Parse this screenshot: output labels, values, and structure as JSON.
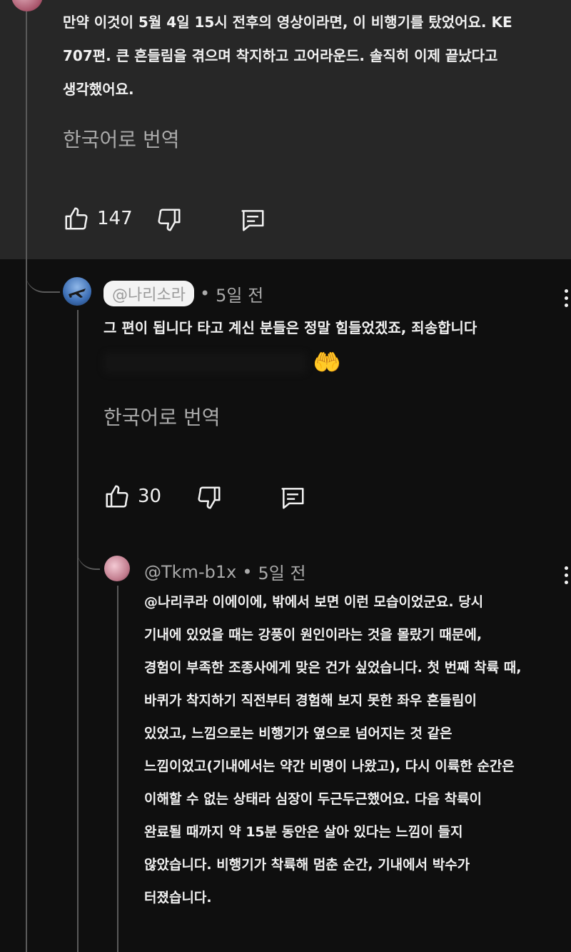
{
  "comment1": {
    "lines": [
      "만약 이것이 5월 4일 15시 전후의 영상이라면, 이 비행기를 탔었어요. KE",
      "707편. 큰 흔들림을 겪으며 착지하고 고어라운드. 솔직히 이제 끝났다고",
      "생각했어요."
    ],
    "translate_label": "한국어로 번역",
    "like_count": "147"
  },
  "reply1": {
    "handle": "@나리소라",
    "time": "5일 전",
    "separator": "•",
    "text": "그 편이 됩니다 타고 계신 분들은 정말 힘들었겠죠, 죄송합니다",
    "emoji": "🤲",
    "translate_label": "한국어로 번역",
    "like_count": "30"
  },
  "reply2": {
    "handle": "@Tkm-b1x",
    "time": "5일 전",
    "separator": "•",
    "lines": [
      "@나리쿠라 이에이에, 밖에서 보면 이런 모습이었군요. 당시",
      "기내에 있었을 때는 강풍이 원인이라는 것을 몰랐기 때문에,",
      "경험이 부족한 조종사에게 맞은 건가 싶었습니다. 첫 번째 착륙 때,",
      "바퀴가 착지하기 직전부터 경험해 보지 못한 좌우 흔들림이",
      "있었고, 느낌으로는 비행기가 옆으로 넘어지는 것 같은",
      "느낌이었고(기내에서는 약간 비명이 나왔고), 다시 이륙한 순간은",
      "이해할 수 없는 상태라 심장이 두근두근했어요. 다음 착륙이",
      "완료될 때까지 약 15분 동안은 살아 있다는 느낌이 들지",
      "않았습니다. 비행기가 착륙해 멈춘 순간, 기내에서 박수가",
      "터졌습니다."
    ]
  },
  "icons": {
    "like": "thumb-up-icon",
    "dislike": "thumb-down-icon",
    "reply": "comment-reply-icon",
    "more": "more-vert-icon"
  },
  "colors": {
    "top_panel": "#272727",
    "background": "#0f0f0f",
    "secondary_text": "#aaaaaa"
  }
}
